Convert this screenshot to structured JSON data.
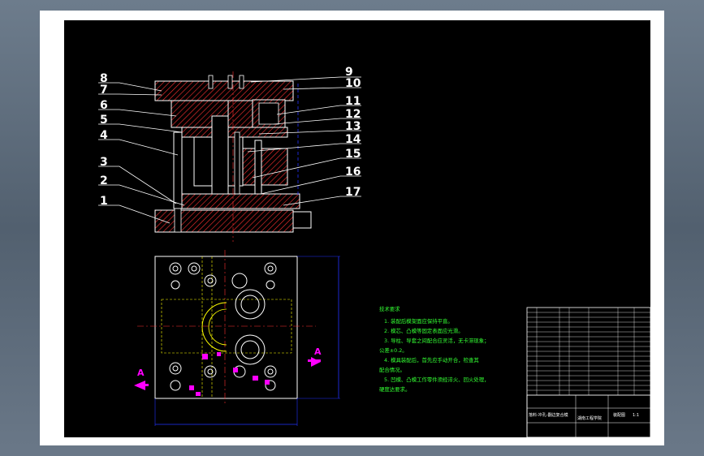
{
  "callouts": {
    "left": [
      "8",
      "7",
      "6",
      "5",
      "4",
      "3",
      "2",
      "1"
    ],
    "right": [
      "9",
      "10",
      "11",
      "12",
      "13",
      "14",
      "15",
      "16",
      "17"
    ]
  },
  "notes": {
    "heading": "技术要求",
    "lines": [
      "1. 装配后模架面应保持平直。",
      "2. 模芯、凸模等固定表面应光滑。",
      "3. 导柱、导套之间配合应灵活，无卡滞现象；",
      "   公差±0.2。",
      "4. 模具装配后，首先应手动开合，检查其",
      "   配合情况。",
      "5. 凹模、凸模工作零件须经淬火、回火处理，",
      "   硬度达要求。"
    ]
  },
  "section_marks": {
    "left": "A",
    "right": "A"
  },
  "title_block": {
    "drawing_title": "落料-冲孔-翻边复合模",
    "school": "湖南工程学院",
    "scale": "1:1",
    "sheet_label": "装配图"
  },
  "colors": {
    "background": "#000000",
    "outline": "#ffffff",
    "hatch": "#ff3030",
    "hidden": "#ffff00",
    "dimension": "#2233ff",
    "notes": "#33ff33",
    "section": "#ff00ff"
  }
}
